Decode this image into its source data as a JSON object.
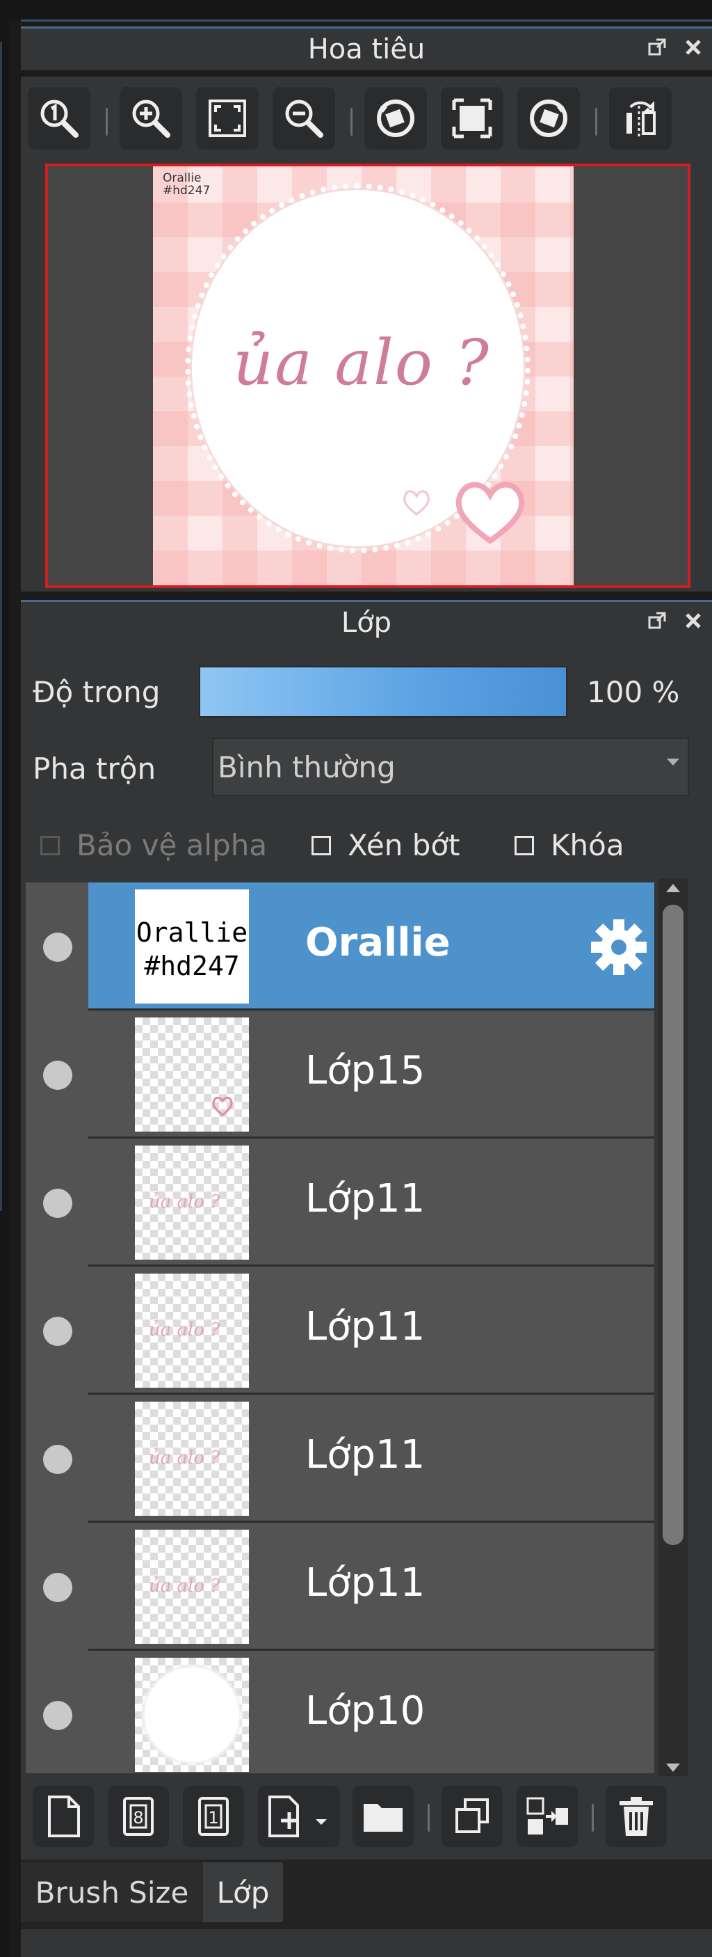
{
  "navigator": {
    "title": "Hoa tiêu",
    "toolbar_icons": [
      "zoom-actual-icon",
      "zoom-in-icon",
      "fit-screen-icon",
      "zoom-out-icon",
      "rotate-left-icon",
      "fullscreen-icon",
      "rotate-right-icon",
      "flip-horizontal-icon"
    ],
    "preview": {
      "signature_line1": "Orallie",
      "signature_line2": "#hd247",
      "artwork_text": "ủa alo ?"
    }
  },
  "layers_panel": {
    "title": "Lớp",
    "opacity_label": "Độ trong",
    "opacity_value": 100,
    "opacity_text": "100 %",
    "blend_label": "Pha trộn",
    "blend_value": "Bình thường",
    "checkboxes": {
      "protect_alpha": "Bảo vệ alpha",
      "clipping": "Xén bớt",
      "lock": "Khóa"
    },
    "layers": [
      {
        "name": "Orallie",
        "thumb_line1": "Orallie",
        "thumb_line2": "#hd247",
        "selected": true
      },
      {
        "name": "Lớp15"
      },
      {
        "name": "Lớp11",
        "thumb_text": "ủa alo ?"
      },
      {
        "name": "Lớp11",
        "thumb_text": "ủa alo ?"
      },
      {
        "name": "Lớp11",
        "thumb_text": "ủa alo ?"
      },
      {
        "name": "Lớp11",
        "thumb_text": "ủa alo ?"
      },
      {
        "name": "Lớp10"
      }
    ],
    "toolbar_icons": [
      "new-layer-icon",
      "new-8bit-layer-icon",
      "new-1bit-layer-icon",
      "add-layer-menu-icon",
      "new-folder-icon",
      "duplicate-layer-icon",
      "merge-layer-icon",
      "delete-layer-icon"
    ]
  },
  "bottom_tabs": [
    "Brush Size",
    "Lớp"
  ],
  "colors": {
    "accent": "#4e92cb",
    "preview_border": "#d01f23",
    "panel": "#333537"
  }
}
